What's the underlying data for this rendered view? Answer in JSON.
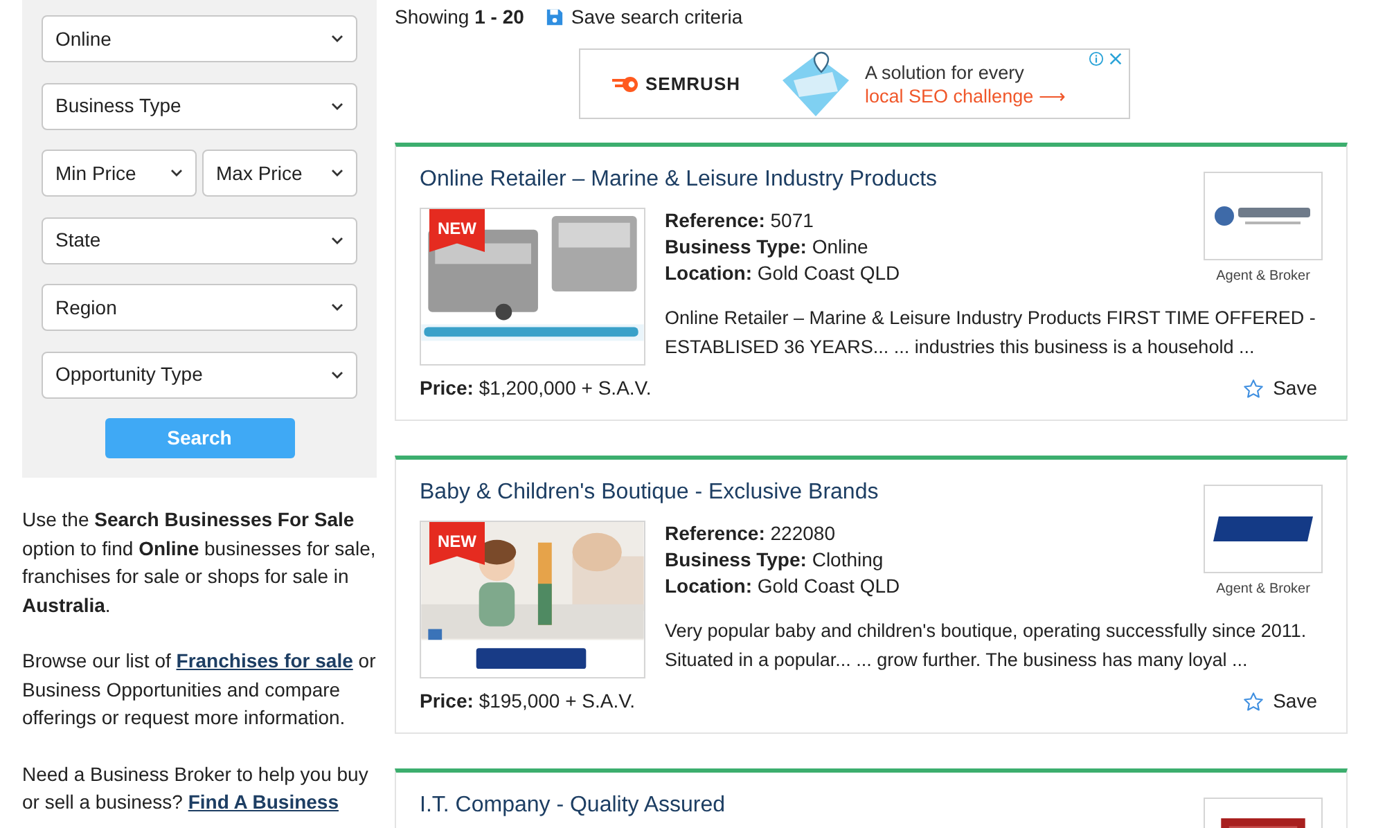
{
  "filters": {
    "rows": [
      {
        "selects": [
          "Online"
        ]
      },
      {
        "selects": [
          "Business Type"
        ]
      },
      {
        "selects": [
          "Min Price",
          "Max Price"
        ]
      },
      {
        "selects": [
          "State"
        ]
      },
      {
        "selects": [
          "Region"
        ]
      },
      {
        "selects": [
          "Opportunity Type"
        ]
      }
    ],
    "search_button": "Search"
  },
  "intro": [
    [
      {
        "kind": "text",
        "text": "Use the **Search Businesses For Sale** option to find **Online** businesses for sale, franchises for sale or shops for sale in **Australia**."
      }
    ],
    [
      {
        "kind": "text",
        "text": "Browse our list of "
      },
      {
        "kind": "link",
        "text": "Franchises for sale"
      },
      {
        "kind": "text",
        "text": " or Business Opportunities and compare offerings or request more information."
      }
    ],
    [
      {
        "kind": "text",
        "text": "Need a Business Broker to help you buy or sell a business? "
      },
      {
        "kind": "link",
        "text": "Find A Business"
      }
    ]
  ],
  "results_header": {
    "showing": "Showing **1 - 20**",
    "save_criteria": "Save search criteria"
  },
  "ad": {
    "brand": "SEMRUSH",
    "line1": "A solution for every",
    "line2": "local SEO challenge ⟶"
  },
  "listings": [
    {
      "title": "Online Retailer – Marine & Leisure Industry Products",
      "badge": "NEW",
      "fields": [
        {
          "label": "Reference:",
          "value": "5071"
        },
        {
          "label": "Business Type:",
          "value": "Online"
        },
        {
          "label": "Location:",
          "value": "Gold Coast QLD"
        }
      ],
      "description": "Online Retailer – Marine & Leisure Industry Products FIRST TIME OFFERED - ESTABLISED 36 YEARS... ... industries this business is a household ...",
      "broker_label": "Agent & Broker",
      "price_label": "Price:",
      "price": "$1,200,000 + S.A.V.",
      "save": "Save",
      "saved": false
    },
    {
      "title": "Baby & Children's Boutique - Exclusive Brands",
      "badge": "NEW",
      "fields": [
        {
          "label": "Reference:",
          "value": "222080"
        },
        {
          "label": "Business Type:",
          "value": "Clothing"
        },
        {
          "label": "Location:",
          "value": "Gold Coast QLD"
        }
      ],
      "description": "Very popular baby and children's boutique, operating successfully since 2011. Situated in a popular... ... grow further. The business has many loyal ...",
      "broker_label": "Agent & Broker",
      "price_label": "Price:",
      "price": "$195,000 + S.A.V.",
      "save": "Save",
      "saved": false
    },
    {
      "title": "I.T. Company - Quality Assured"
    }
  ]
}
